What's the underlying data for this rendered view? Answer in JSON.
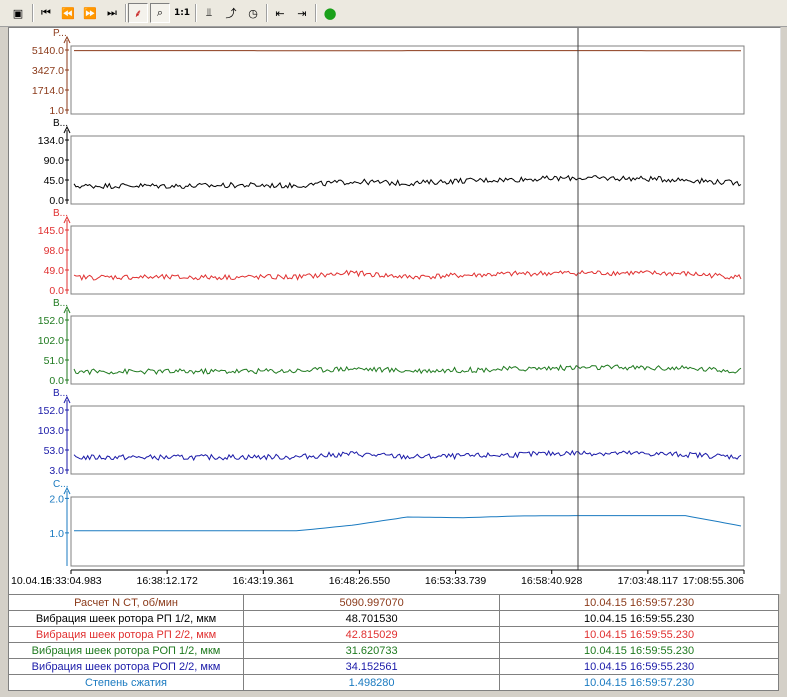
{
  "toolbar": {
    "buttons": [
      {
        "name": "settings-icon",
        "glyph": "▣"
      },
      {
        "name": "go-start-icon",
        "glyph": "⏮"
      },
      {
        "name": "rewind-icon",
        "glyph": "⏪"
      },
      {
        "name": "fast-forward-icon",
        "glyph": "⏩"
      },
      {
        "name": "go-end-icon",
        "glyph": "⏭"
      },
      {
        "name": "chart-mode-icon",
        "glyph": "⸙"
      },
      {
        "name": "zoom-icon",
        "glyph": "⌕"
      },
      {
        "name": "zoom-reset-button",
        "glyph": "1:1"
      },
      {
        "name": "pen-icon",
        "glyph": "⫫"
      },
      {
        "name": "trend-icon",
        "glyph": "⤴"
      },
      {
        "name": "clock-icon",
        "glyph": "◷"
      },
      {
        "name": "export-left-icon",
        "glyph": "⇤"
      },
      {
        "name": "export-right-icon",
        "glyph": "⇥"
      },
      {
        "name": "status-indicator-icon",
        "glyph": "●"
      }
    ]
  },
  "colors": {
    "brown": "#8b3a1a",
    "black": "#000000",
    "red": "#e03030",
    "green": "#1f7a1f",
    "blue": "#1a1aa8",
    "cyan": "#1a7ac0"
  },
  "chart_data": [
    {
      "type": "line",
      "name": "P...",
      "color": "#8b3a1a",
      "ticks": [
        "5140.0",
        "3427.0",
        "1714.0",
        "1.0"
      ],
      "ylim": [
        1.0,
        5140.0
      ],
      "values": [
        5090,
        5090,
        5090,
        5088,
        5070,
        5070,
        5085,
        5090,
        5090,
        5090,
        5088,
        5070,
        5070
      ]
    },
    {
      "type": "line",
      "name": "B...",
      "color": "#000000",
      "ticks": [
        "134.0",
        "90.0",
        "45.0",
        "0.0"
      ],
      "ylim": [
        0.0,
        134.0
      ],
      "values": [
        30,
        31,
        30,
        32,
        31,
        40,
        36,
        42,
        45,
        48,
        47,
        44,
        36
      ]
    },
    {
      "type": "line",
      "name": "B...",
      "color": "#e03030",
      "ticks": [
        "145.0",
        "98.0",
        "49.0",
        "0.0"
      ],
      "ylim": [
        0.0,
        145.0
      ],
      "values": [
        29,
        30,
        29,
        30,
        30,
        40,
        30,
        34,
        38,
        40,
        40,
        38,
        30
      ]
    },
    {
      "type": "line",
      "name": "B...",
      "color": "#1f7a1f",
      "ticks": [
        "152.0",
        "102.0",
        "51.0",
        "0.0"
      ],
      "ylim": [
        0.0,
        152.0
      ],
      "values": [
        20,
        20,
        20,
        21,
        22,
        28,
        22,
        24,
        27,
        30,
        30,
        28,
        22
      ]
    },
    {
      "type": "line",
      "name": "B...",
      "color": "#1a1aa8",
      "ticks": [
        "152.0",
        "103.0",
        "53.0",
        "3.0"
      ],
      "ylim": [
        3.0,
        152.0
      ],
      "values": [
        33,
        33,
        33,
        34,
        34,
        42,
        34,
        36,
        40,
        44,
        43,
        40,
        34
      ]
    },
    {
      "type": "line",
      "name": "C...",
      "color": "#1a7ac0",
      "ticks": [
        "2.0",
        "1.0"
      ],
      "ylim": [
        0.0,
        2.0
      ],
      "values": [
        1.06,
        1.06,
        1.06,
        1.06,
        1.06,
        1.22,
        1.46,
        1.44,
        1.49,
        1.5,
        1.5,
        1.5,
        1.2
      ]
    }
  ],
  "time_axis": {
    "date": "10.04.15",
    "labels": [
      "16:33:04.983",
      "16:38:12.172",
      "16:43:19.361",
      "16:48:26.550",
      "16:53:33.739",
      "16:58:40.928",
      "17:03:48.117",
      "17:08:55.306"
    ],
    "cursor_time": "16:59:55"
  },
  "table": {
    "rows": [
      {
        "name": "Расчет N CT, об/мин",
        "value": "5090.997070",
        "time": "10.04.15 16:59:57.230",
        "color": "#8b3a1a"
      },
      {
        "name": "Вибрация шеек ротора РП 1/2, мкм",
        "value": "48.701530",
        "time": "10.04.15 16:59:55.230",
        "color": "#000000"
      },
      {
        "name": "Вибрация шеек ротора РП 2/2, мкм",
        "value": "42.815029",
        "time": "10.04.15 16:59:55.230",
        "color": "#e03030"
      },
      {
        "name": "Вибрация шеек ротора РОП 1/2, мкм",
        "value": "31.620733",
        "time": "10.04.15 16:59:55.230",
        "color": "#1f7a1f"
      },
      {
        "name": "Вибрация шеек ротора РОП 2/2, мкм",
        "value": "34.152561",
        "time": "10.04.15 16:59:55.230",
        "color": "#1a1aa8"
      },
      {
        "name": "Степень сжатия",
        "value": "1.498280",
        "time": "10.04.15 16:59:57.230",
        "color": "#1a7ac0"
      }
    ]
  }
}
